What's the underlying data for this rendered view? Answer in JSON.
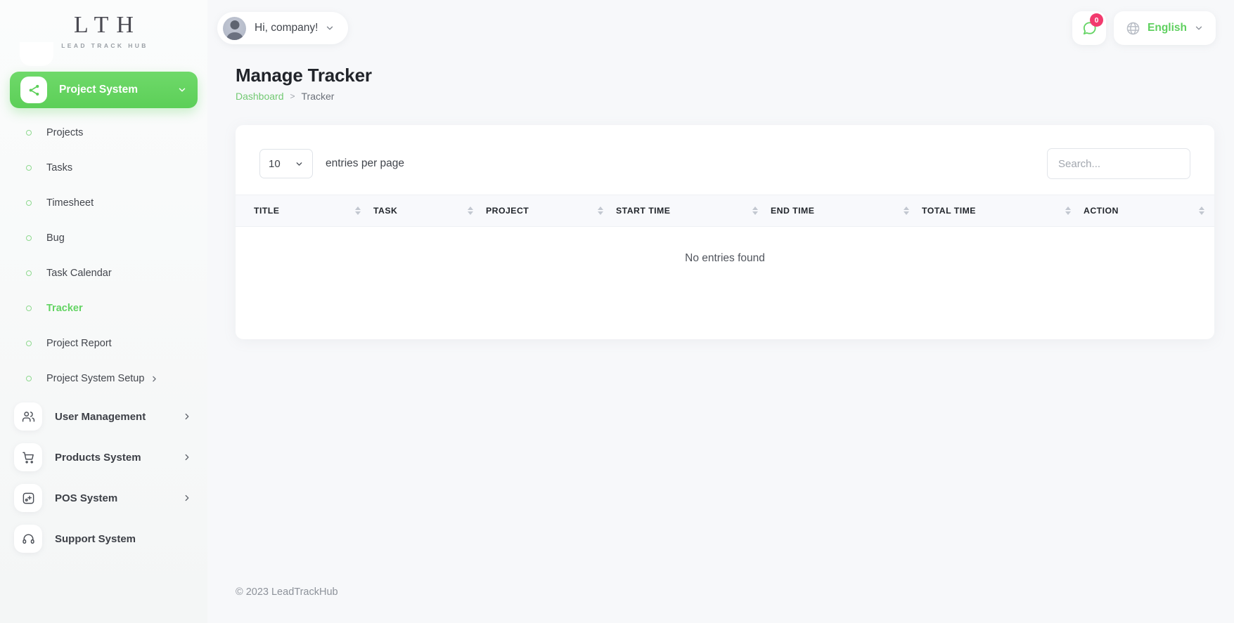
{
  "brand": {
    "logo_text": "LTH",
    "logo_subtitle": "LEAD TRACK HUB"
  },
  "colors": {
    "accent_green": "#62d662",
    "badge_pink": "#f23a6e",
    "text_dark": "#21242a",
    "muted": "#8d929a"
  },
  "sidebar": {
    "active_group": {
      "label": "Project System",
      "icon": "share-icon",
      "chevron": "chevron-down-icon"
    },
    "submenu": [
      {
        "label": "Projects",
        "active": false
      },
      {
        "label": "Tasks",
        "active": false
      },
      {
        "label": "Timesheet",
        "active": false
      },
      {
        "label": "Bug",
        "active": false
      },
      {
        "label": "Task Calendar",
        "active": false
      },
      {
        "label": "Tracker",
        "active": true
      },
      {
        "label": "Project Report",
        "active": false
      },
      {
        "label": "Project System Setup",
        "active": false,
        "chevron": "chevron-right-icon"
      }
    ],
    "groups": [
      {
        "label": "User Management",
        "icon": "users-icon",
        "chevron": "chevron-right-icon"
      },
      {
        "label": "Products System",
        "icon": "cart-icon",
        "chevron": "chevron-right-icon"
      },
      {
        "label": "POS System",
        "icon": "pos-grid-icon",
        "chevron": "chevron-right-icon"
      },
      {
        "label": "Support System",
        "icon": "headset-icon",
        "chevron": ""
      }
    ]
  },
  "topbar": {
    "user_greeting": "Hi, company!",
    "user_chevron": "chevron-down-icon",
    "avatar": "avatar",
    "chat_icon": "chat-bubble-icon",
    "notification_count": "0",
    "language_icon": "globe-icon",
    "language": "English",
    "language_chevron": "chevron-down-icon"
  },
  "page": {
    "title": "Manage Tracker",
    "breadcrumb": {
      "root": "Dashboard",
      "separator": ">",
      "current": "Tracker"
    }
  },
  "toolbar": {
    "entries_value": "10",
    "entries_chevron": "chevron-down-icon",
    "entries_label": "entries per page",
    "search_placeholder": "Search..."
  },
  "table": {
    "columns": [
      "TITLE",
      "TASK",
      "PROJECT",
      "START TIME",
      "END TIME",
      "TOTAL TIME",
      "ACTION"
    ],
    "rows": [],
    "empty_message": "No entries found"
  },
  "footer": {
    "copyright": "© 2023 LeadTrackHub"
  }
}
